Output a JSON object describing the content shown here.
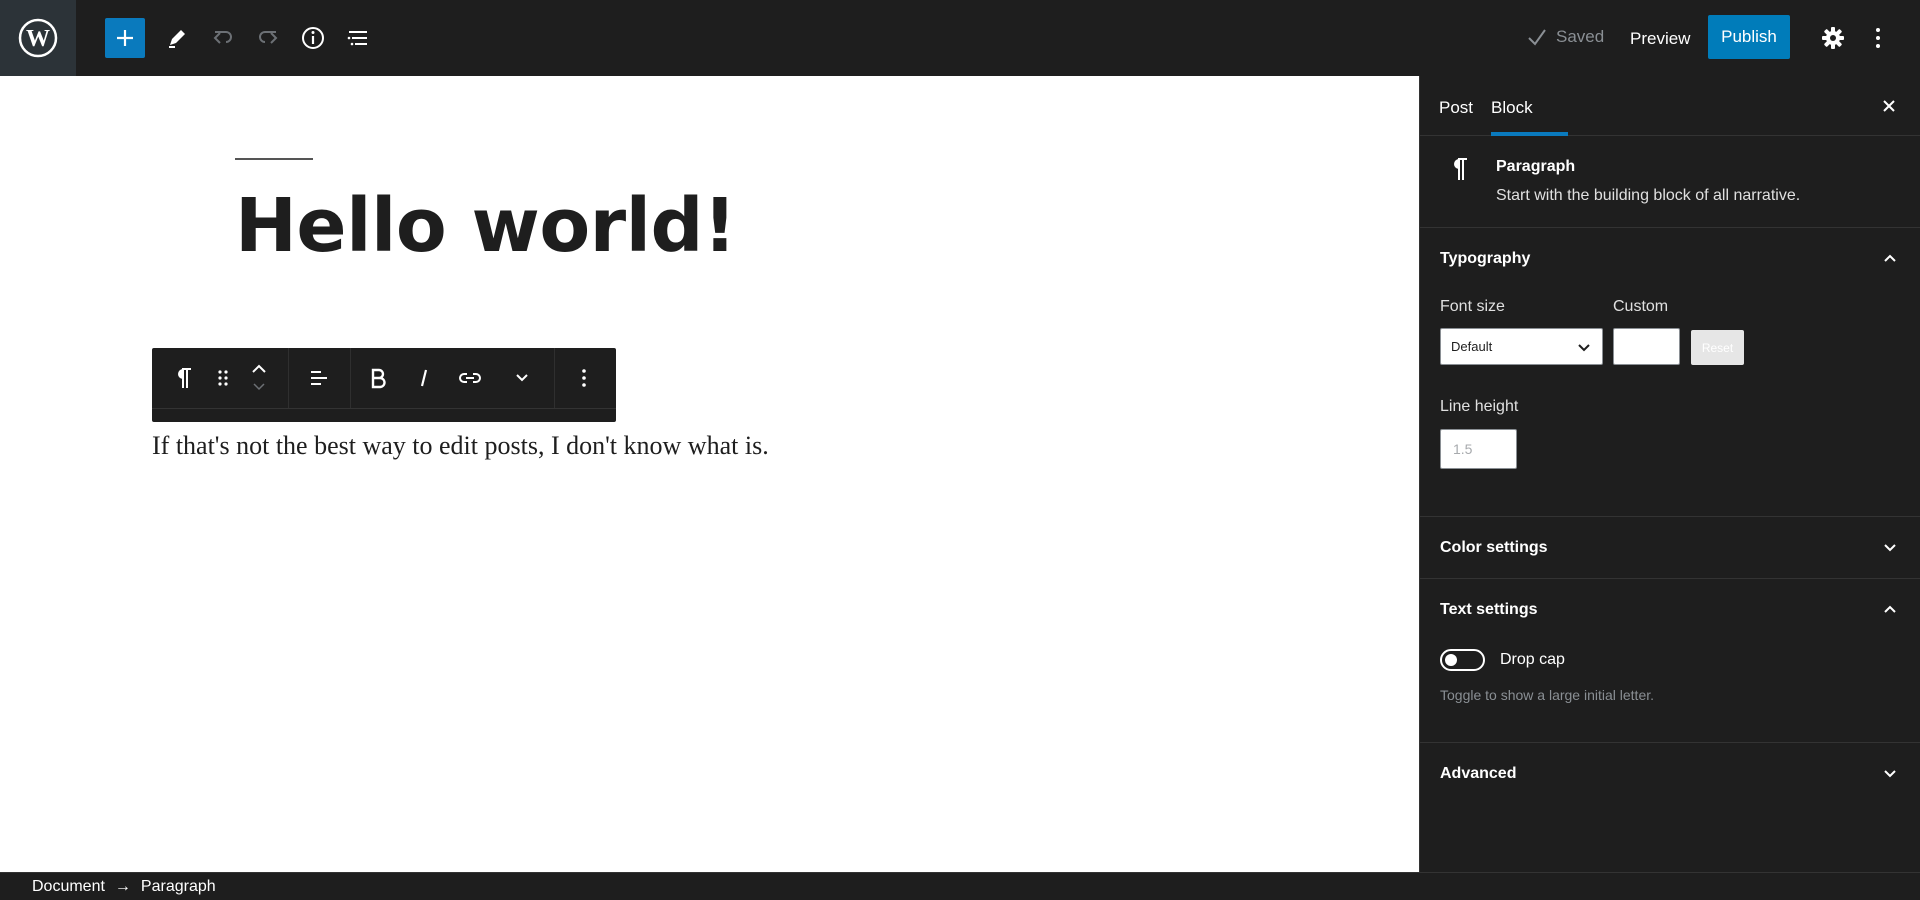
{
  "topbar": {
    "saved_label": "Saved",
    "preview_label": "Preview",
    "publish_label": "Publish",
    "icons": [
      "wordpress-logo",
      "add-block",
      "tools-pencil",
      "undo",
      "redo",
      "details-info",
      "list-view",
      "settings-gear",
      "options-kebab"
    ]
  },
  "editor": {
    "post_title": "Hello world!",
    "paragraph_text": "If that's not the best way to edit posts, I don't know what is."
  },
  "sidebar": {
    "tabs": [
      {
        "label": "Post"
      },
      {
        "label": "Block",
        "active": true
      }
    ],
    "block_card": {
      "title": "Paragraph",
      "description": "Start with the building block of all narrative."
    },
    "typography": {
      "title": "Typography",
      "font_size_label": "Font size",
      "custom_label": "Custom",
      "font_size_value": "Default",
      "reset_label": "Reset",
      "line_height_label": "Line height",
      "line_height_placeholder": "1.5"
    },
    "color_settings": {
      "title": "Color settings"
    },
    "text_settings": {
      "title": "Text settings",
      "drop_cap_label": "Drop cap",
      "drop_cap_help": "Toggle to show a large initial letter."
    },
    "advanced": {
      "title": "Advanced"
    }
  },
  "footer": {
    "breadcrumb_root": "Document",
    "breadcrumb_arrow": "→",
    "breadcrumb_current": "Paragraph"
  },
  "colors": {
    "accent": "#007cba",
    "dark": "#1e1e1e",
    "canvas": "#ffffff"
  }
}
